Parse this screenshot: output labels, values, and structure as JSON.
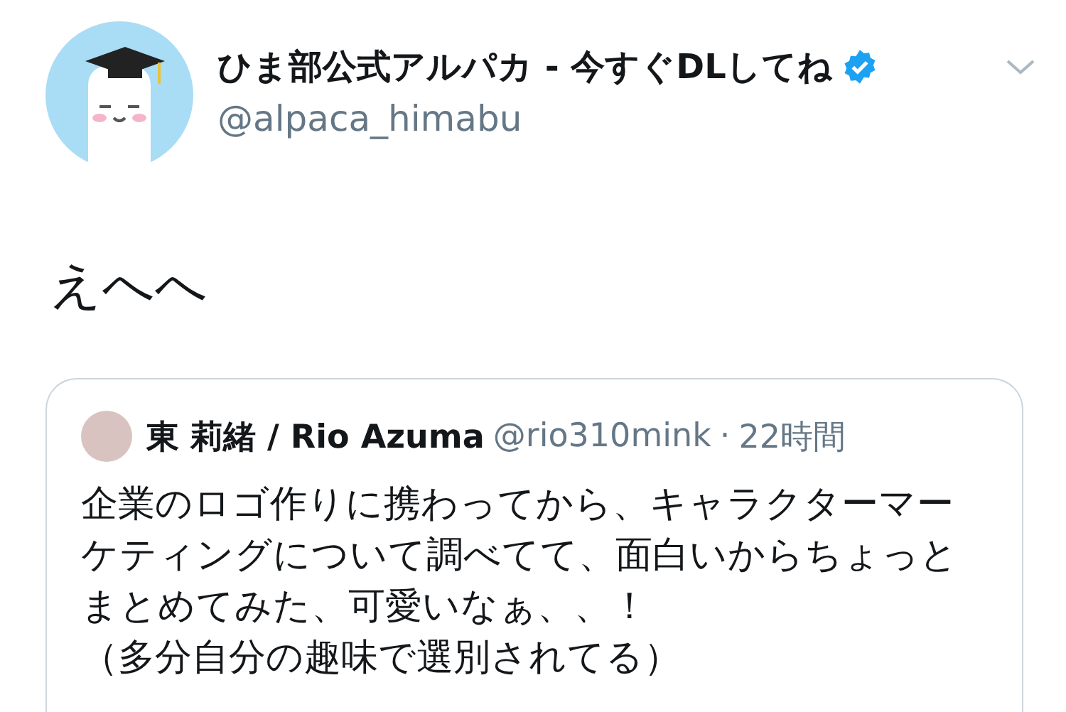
{
  "author": {
    "name": "ひま部公式アルパカ - 今すぐDLしてね",
    "verified": true,
    "handle": "@alpaca_himabu"
  },
  "tweet": {
    "text": "えへへ"
  },
  "quoted": {
    "name": "東 莉緒 / Rio Azuma",
    "handle": "@rio310mink",
    "separator": "·",
    "time": "22時間",
    "paragraphs": [
      "企業のロゴ作りに携わってから、キャラクターマーケティングについて調べてて、面白いからちょっとまとめてみた、可愛いなぁ、、！",
      "（多分自分の趣味で選別されてる）"
    ]
  }
}
